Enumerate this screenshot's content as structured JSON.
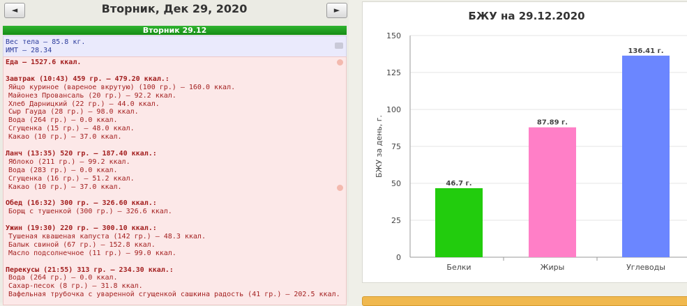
{
  "nav": {
    "prev_icon": "◄",
    "next_icon": "►",
    "date_title": "Вторник, Дек 29, 2020"
  },
  "day_header": "Вторник 29.12",
  "weight_box": {
    "line1": "Вес тела — 85.8 кг.",
    "line2": "ИМТ — 28.34"
  },
  "food_log": {
    "total": "Еда — 1527.6 ккал.",
    "meals": [
      {
        "title": "Завтрак (10:43) 459 гр. — 479.20 ккал.:",
        "items": [
          "Яйцо куриное (вареное вкрутую) (100 гр.) — 160.0 ккал.",
          "Майонез Провансаль (20 гр.) — 92.2 ккал.",
          "Хлеб Дарницкий (22 гр.) — 44.0 ккал.",
          "Сыр Гауда (28 гр.) — 98.0 ккал.",
          "Вода (264 гр.) — 0.0 ккал.",
          "Сгущенка (15 гр.) — 48.0 ккал.",
          "Какао (10 гр.) — 37.0 ккал."
        ]
      },
      {
        "title": "Ланч (13:35) 520 гр. — 187.40 ккал.:",
        "items": [
          "Яблоко (211 гр.) — 99.2 ккал.",
          "Вода (283 гр.) — 0.0 ккал.",
          "Сгущенка (16 гр.) — 51.2 ккал.",
          "Какао (10 гр.) — 37.0 ккал."
        ]
      },
      {
        "title": "Обед (16:32) 300 гр. — 326.60 ккал.:",
        "items": [
          "Борщ с тушенкой (300 гр.) — 326.6 ккал."
        ]
      },
      {
        "title": "Ужин (19:30) 220 гр. — 300.10 ккал.:",
        "items": [
          "Тушеная квашеная капуста (142 гр.) — 48.3 ккал.",
          "Балык свиной (67 гр.) — 152.8 ккал.",
          "Масло подсолнечное (11 гр.) — 99.0 ккал."
        ]
      },
      {
        "title": "Перекусы (21:55) 313 гр. — 234.30 ккал.:",
        "items": [
          "Вода (264 гр.) — 0.0 ккал.",
          "Сахар-песок (8 гр.) — 31.8 ккал.",
          "Вафельная трубочка с уваренной сгущенкой сашкина радость (41 гр.) — 202.5 ккал."
        ]
      }
    ]
  },
  "chart_data": {
    "type": "bar",
    "title": "БЖУ на 29.12.2020",
    "ylabel": "БЖУ за день, г.",
    "xlabel": "",
    "categories": [
      "Белки",
      "Жиры",
      "Углеводы"
    ],
    "values": [
      46.7,
      87.89,
      136.41
    ],
    "value_labels": [
      "46.7 г.",
      "87.89 г.",
      "136.41 г."
    ],
    "colors": [
      "#22cc0d",
      "#ff7fc7",
      "#6b86ff"
    ],
    "ylim": [
      0,
      150
    ],
    "yticks": [
      0,
      25,
      50,
      75,
      100,
      125,
      150
    ],
    "grid": true
  }
}
